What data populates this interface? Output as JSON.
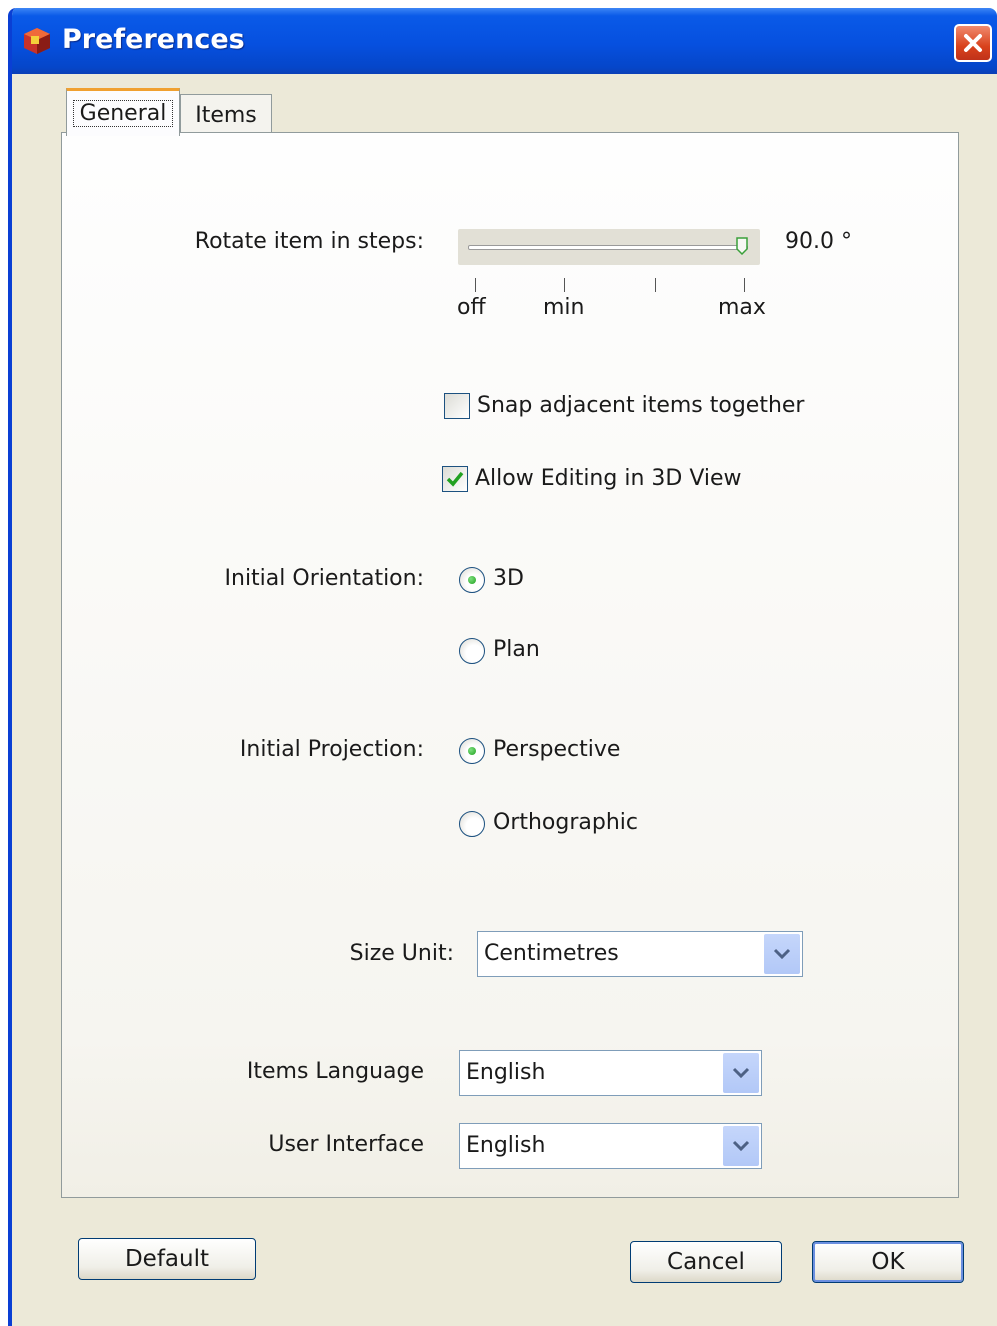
{
  "window": {
    "title": "Preferences",
    "app_icon": "app-cube-icon",
    "close_icon": "close-icon"
  },
  "tabs": [
    {
      "label": "General",
      "selected": true
    },
    {
      "label": "Items",
      "selected": false
    }
  ],
  "rotate": {
    "label": "Rotate item in steps:",
    "value_text": "90.0 °",
    "slider_level_fraction": 1.0,
    "ticks": [
      "off",
      "min",
      "",
      "max"
    ]
  },
  "snap": {
    "label": "Snap adjacent items together",
    "checked": false
  },
  "allow_3d": {
    "label": "Allow Editing in 3D View",
    "checked": true
  },
  "orientation": {
    "label": "Initial Orientation:",
    "options": [
      {
        "label": "3D",
        "selected": true
      },
      {
        "label": "Plan",
        "selected": false
      }
    ]
  },
  "projection": {
    "label": "Initial Projection:",
    "options": [
      {
        "label": "Perspective",
        "selected": true
      },
      {
        "label": "Orthographic",
        "selected": false
      }
    ]
  },
  "size_unit": {
    "label": "Size Unit:",
    "value": "Centimetres"
  },
  "items_language": {
    "label": "Items Language",
    "value": "English"
  },
  "user_interface": {
    "label": "User Interface",
    "value": "English"
  },
  "buttons": {
    "default": "Default",
    "cancel": "Cancel",
    "ok": "OK"
  },
  "colors": {
    "title_bar": "#0650df",
    "window_bg": "#ece9d8",
    "close_button": "#d9421c",
    "check_green": "#21a121"
  }
}
